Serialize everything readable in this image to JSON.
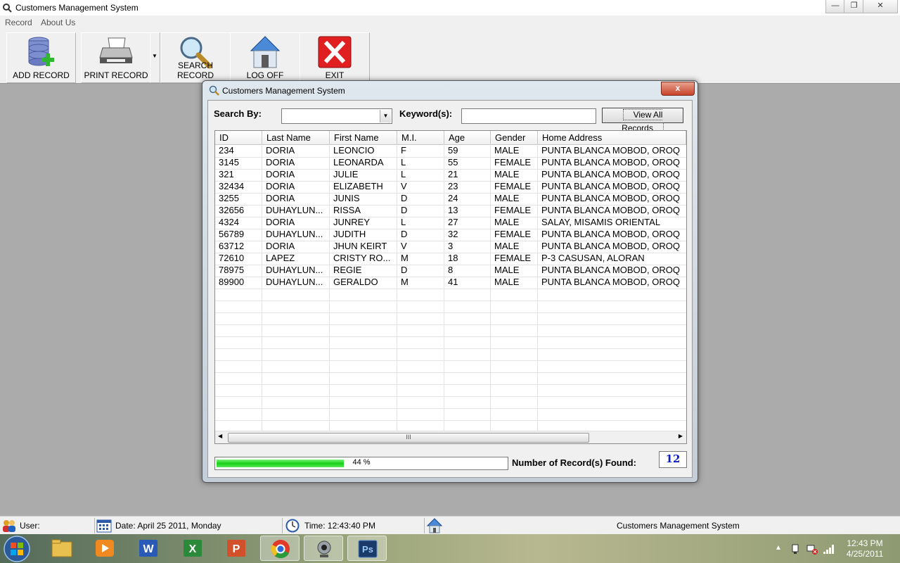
{
  "window": {
    "title": "Customers Management System"
  },
  "menu": [
    {
      "label": "Record"
    },
    {
      "label": "About Us"
    }
  ],
  "toolbar": {
    "add": "ADD RECORD",
    "print": "PRINT RECORD",
    "search": "SEARCH RECORD",
    "logoff": "LOG OFF",
    "exit": "EXIT"
  },
  "dialog": {
    "title": "Customers Management System",
    "close_label": "x",
    "search_by_label": "Search By:",
    "search_by_value": "",
    "keyword_label": "Keyword(s):",
    "keyword_value": "",
    "view_all_label": "View All Records",
    "columns": [
      "ID",
      "Last Name",
      "First Name",
      "M.I.",
      "Age",
      "Gender",
      "Home Address"
    ],
    "rows": [
      [
        "234",
        "DORIA",
        "LEONCIO",
        "F",
        "59",
        "MALE",
        "PUNTA BLANCA MOBOD, OROQ"
      ],
      [
        "3145",
        "DORIA",
        "LEONARDA",
        "L",
        "55",
        "FEMALE",
        "PUNTA BLANCA MOBOD, OROQ"
      ],
      [
        "321",
        "DORIA",
        "JULIE",
        "L",
        "21",
        "MALE",
        "PUNTA BLANCA MOBOD, OROQ"
      ],
      [
        "32434",
        "DORIA",
        "ELIZABETH",
        "V",
        "23",
        "FEMALE",
        "PUNTA BLANCA MOBOD, OROQ"
      ],
      [
        "3255",
        "DORIA",
        "JUNIS",
        "D",
        "24",
        "MALE",
        "PUNTA BLANCA MOBOD, OROQ"
      ],
      [
        "32656",
        "DUHAYLUN...",
        "RISSA",
        "D",
        "13",
        "FEMALE",
        "PUNTA BLANCA MOBOD, OROQ"
      ],
      [
        "4324",
        "DORIA",
        "JUNREY",
        "L",
        "27",
        "MALE",
        "SALAY, MISAMIS ORIENTAL"
      ],
      [
        "56789",
        "DUHAYLUN...",
        "JUDITH",
        "D",
        "32",
        "FEMALE",
        "PUNTA BLANCA MOBOD, OROQ"
      ],
      [
        "63712",
        "DORIA",
        "JHUN KEIRT",
        "V",
        "3",
        "MALE",
        "PUNTA BLANCA MOBOD, OROQ"
      ],
      [
        "72610",
        "LAPEZ",
        "CRISTY RO...",
        "M",
        "18",
        "FEMALE",
        "P-3 CASUSAN, ALORAN"
      ],
      [
        "78975",
        "DUHAYLUN...",
        "REGIE",
        "D",
        "8",
        "MALE",
        "PUNTA BLANCA MOBOD, OROQ"
      ],
      [
        "89900",
        "DUHAYLUN...",
        "GERALDO",
        "M",
        "41",
        "MALE",
        "PUNTA BLANCA MOBOD, OROQ"
      ]
    ],
    "scroll_grip": "III",
    "progress_percent": 44,
    "progress_label": "44 %",
    "count_label": "Number of Record(s) Found:",
    "count_value": "12"
  },
  "status": {
    "user": "User:",
    "date": "Date: April 25 2011, Monday",
    "time": "Time: 12:43:40 PM",
    "app": "Customers Management System"
  },
  "taskbar": {
    "time": "12:43 PM",
    "date": "4/25/2011"
  },
  "colors": {
    "progress": "#16d116",
    "count_text": "#0a1ec8",
    "exit_red": "#e02020"
  }
}
